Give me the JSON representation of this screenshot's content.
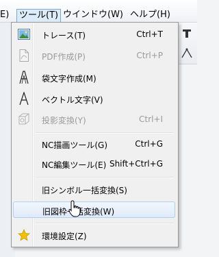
{
  "menubar": {
    "file_label": "E)",
    "tool_label": "ツール(T)",
    "window_label": "ウインドウ(W)",
    "help_label": "ヘルプ(H)"
  },
  "toolbar": {
    "icons": [
      "font-icon",
      "line-icon"
    ]
  },
  "menu": {
    "items": [
      {
        "label": "トレース(T)",
        "shortcut": "Ctrl+T",
        "icon": "trace-image-icon",
        "enabled": true
      },
      {
        "label": "PDF作成(P)",
        "shortcut": "Ctrl+P",
        "icon": "pdf-icon",
        "enabled": false
      },
      {
        "label": "袋文字作成(M)",
        "shortcut": "",
        "icon": "outline-text-icon",
        "enabled": true
      },
      {
        "label": "ベクトル文字(V)",
        "shortcut": "",
        "icon": "vector-text-icon",
        "enabled": true
      },
      {
        "label": "投影変換(Y)",
        "shortcut": "Ctrl+I",
        "icon": "projection-icon",
        "enabled": false
      },
      {
        "label": "NC描画ツール(G)",
        "shortcut": "Ctrl+G",
        "icon": "",
        "enabled": true
      },
      {
        "label": "NC編集ツール(E)",
        "shortcut": "Shift+Ctrl+G",
        "icon": "",
        "enabled": true
      },
      {
        "label": "旧シンボル一括変換(S)",
        "shortcut": "",
        "icon": "",
        "enabled": true
      },
      {
        "label": "旧図枠一括変換(W)",
        "shortcut": "",
        "icon": "",
        "enabled": true
      },
      {
        "label": "環境設定(Z)",
        "shortcut": "",
        "icon": "star-icon",
        "enabled": true
      }
    ]
  },
  "colors": {
    "hover_bg": "#dfeaf7",
    "hover_border": "#aecff7",
    "disabled_text": "#9a9a9a",
    "star": "#f2c200"
  }
}
